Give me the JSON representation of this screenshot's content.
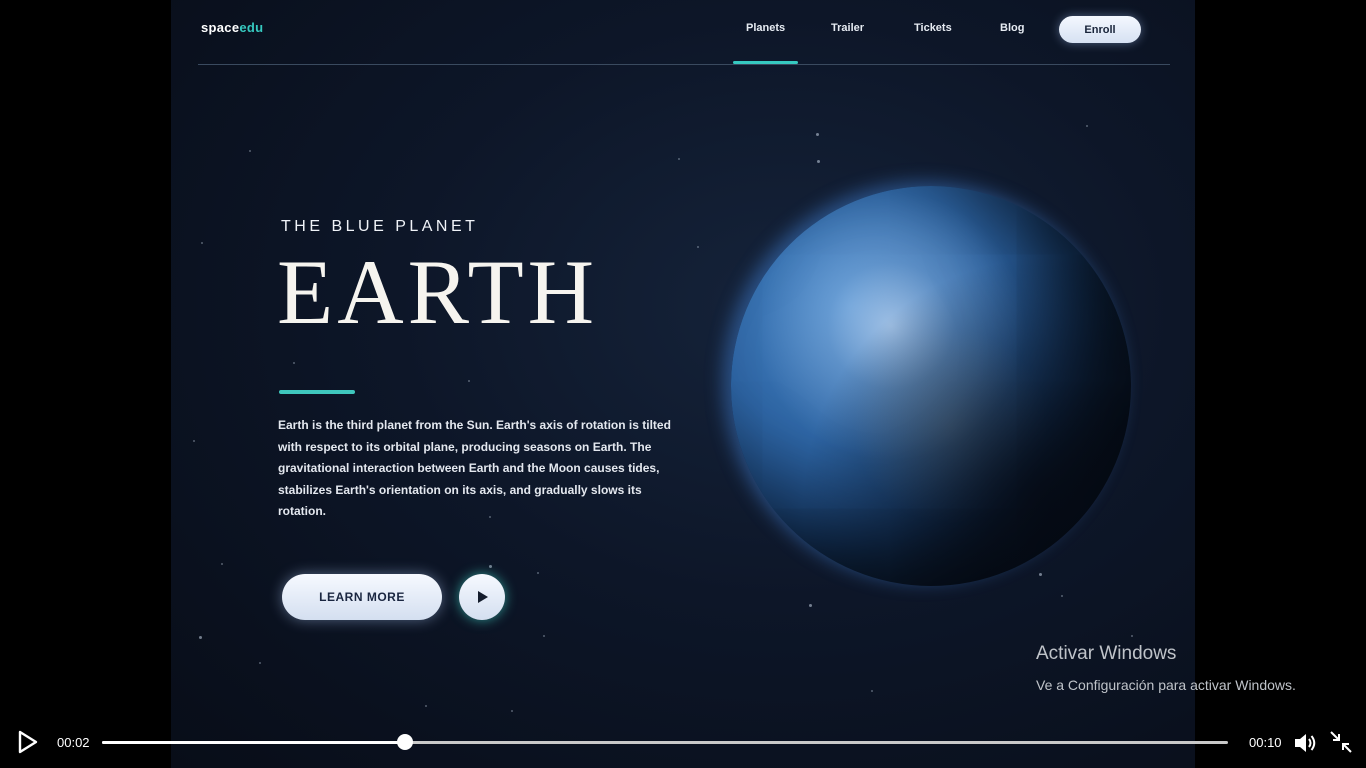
{
  "nav": {
    "logo_part1": "space",
    "logo_part2": "edu",
    "items": [
      "Planets",
      "Trailer",
      "Tickets",
      "Blog"
    ],
    "active_item": "Planets",
    "enroll_label": "Enroll"
  },
  "hero": {
    "eyebrow": "THE BLUE PLANET",
    "title": "EARTH",
    "description": "Earth is the third planet from the Sun. Earth's axis of rotation is tilted with respect to its orbital plane, producing seasons on Earth. The gravitational interaction between Earth and the Moon causes tides, stabilizes Earth's orientation on its axis, and gradually slows its rotation.",
    "learn_more_label": "LEARN MORE"
  },
  "watermark": {
    "title": "Activar Windows",
    "subtitle": "Ve a Configuración para activar Windows."
  },
  "player": {
    "current_time": "00:02",
    "duration": "00:10",
    "progress_fraction": 0.269
  },
  "colors": {
    "accent": "#36c9c0",
    "background": "#0d1628",
    "button": "#e6eefa"
  },
  "icons": {
    "play": "play-icon",
    "volume": "volume-icon",
    "exit_fullscreen": "exit-fullscreen-icon"
  }
}
